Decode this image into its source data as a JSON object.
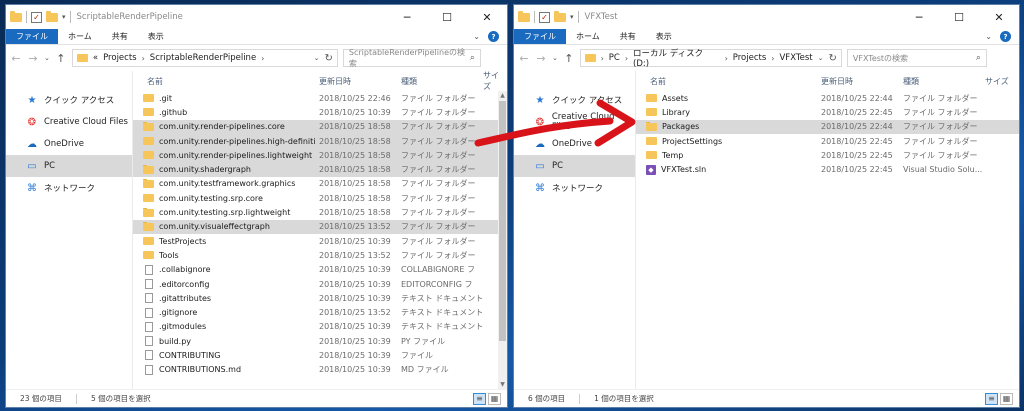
{
  "colors": {
    "accent": "#1a6bc0",
    "selection": "#d9d9d9",
    "folder": "#f6c65a",
    "arrow": "#d8141a"
  },
  "ribbon_tabs": [
    "ファイル",
    "ホーム",
    "共有",
    "表示"
  ],
  "columns": {
    "name": "名前",
    "date": "更新日時",
    "type": "種類",
    "size": "サイズ"
  },
  "nav": [
    {
      "label": "クイック アクセス",
      "icon": "star-icon"
    },
    {
      "label": "Creative Cloud Files",
      "icon": "creative-cloud-icon"
    },
    {
      "label": "OneDrive",
      "icon": "cloud-icon"
    },
    {
      "label": "PC",
      "icon": "computer-icon"
    },
    {
      "label": "ネットワーク",
      "icon": "network-icon"
    }
  ],
  "left": {
    "title": "ScriptableRenderPipeline",
    "path": [
      "«",
      "Projects",
      "ScriptableRenderPipeline"
    ],
    "search_placeholder": "ScriptableRenderPipelineの検索",
    "selected_nav": 3,
    "items": [
      {
        "name": ".git",
        "date": "2018/10/25 22:46",
        "type": "ファイル フォルダー",
        "icon": "folder",
        "selected": false
      },
      {
        "name": ".github",
        "date": "2018/10/25 10:39",
        "type": "ファイル フォルダー",
        "icon": "folder",
        "selected": false
      },
      {
        "name": "com.unity.render-pipelines.core",
        "date": "2018/10/25 18:58",
        "type": "ファイル フォルダー",
        "icon": "folder",
        "selected": true
      },
      {
        "name": "com.unity.render-pipelines.high-definition",
        "date": "2018/10/25 18:58",
        "type": "ファイル フォルダー",
        "icon": "folder",
        "selected": true
      },
      {
        "name": "com.unity.render-pipelines.lightweight",
        "date": "2018/10/25 18:58",
        "type": "ファイル フォルダー",
        "icon": "folder",
        "selected": true
      },
      {
        "name": "com.unity.shadergraph",
        "date": "2018/10/25 18:58",
        "type": "ファイル フォルダー",
        "icon": "folder",
        "selected": true
      },
      {
        "name": "com.unity.testframework.graphics",
        "date": "2018/10/25 18:58",
        "type": "ファイル フォルダー",
        "icon": "folder",
        "selected": false
      },
      {
        "name": "com.unity.testing.srp.core",
        "date": "2018/10/25 18:58",
        "type": "ファイル フォルダー",
        "icon": "folder",
        "selected": false
      },
      {
        "name": "com.unity.testing.srp.lightweight",
        "date": "2018/10/25 18:58",
        "type": "ファイル フォルダー",
        "icon": "folder",
        "selected": false
      },
      {
        "name": "com.unity.visualeffectgraph",
        "date": "2018/10/25 13:52",
        "type": "ファイル フォルダー",
        "icon": "folder",
        "selected": true
      },
      {
        "name": "TestProjects",
        "date": "2018/10/25 10:39",
        "type": "ファイル フォルダー",
        "icon": "folder",
        "selected": false
      },
      {
        "name": "Tools",
        "date": "2018/10/25 13:52",
        "type": "ファイル フォルダー",
        "icon": "folder",
        "selected": false
      },
      {
        "name": ".collabignore",
        "date": "2018/10/25 10:39",
        "type": "COLLABIGNORE フ",
        "icon": "file",
        "selected": false
      },
      {
        "name": ".editorconfig",
        "date": "2018/10/25 10:39",
        "type": "EDITORCONFIG フ",
        "icon": "file",
        "selected": false
      },
      {
        "name": ".gitattributes",
        "date": "2018/10/25 10:39",
        "type": "テキスト ドキュメント",
        "icon": "file",
        "selected": false
      },
      {
        "name": ".gitignore",
        "date": "2018/10/25 13:52",
        "type": "テキスト ドキュメント",
        "icon": "file",
        "selected": false
      },
      {
        "name": ".gitmodules",
        "date": "2018/10/25 10:39",
        "type": "テキスト ドキュメント",
        "icon": "file",
        "selected": false
      },
      {
        "name": "build.py",
        "date": "2018/10/25 10:39",
        "type": "PY ファイル",
        "icon": "file",
        "selected": false
      },
      {
        "name": "CONTRIBUTING",
        "date": "2018/10/25 10:39",
        "type": "ファイル",
        "icon": "file",
        "selected": false
      },
      {
        "name": "CONTRIBUTIONS.md",
        "date": "2018/10/25 10:39",
        "type": "MD ファイル",
        "icon": "file",
        "selected": false
      }
    ],
    "status_count": "23 個の項目",
    "status_selected": "5 個の項目を選択"
  },
  "right": {
    "title": "VFXTest",
    "path": [
      "PC",
      "ローカル ディスク (D:)",
      "Projects",
      "VFXTest"
    ],
    "search_placeholder": "VFXTestの検索",
    "selected_nav": 3,
    "items": [
      {
        "name": "Assets",
        "date": "2018/10/25 22:44",
        "type": "ファイル フォルダー",
        "icon": "folder",
        "selected": false
      },
      {
        "name": "Library",
        "date": "2018/10/25 22:45",
        "type": "ファイル フォルダー",
        "icon": "folder",
        "selected": false
      },
      {
        "name": "Packages",
        "date": "2018/10/25 22:44",
        "type": "ファイル フォルダー",
        "icon": "folder",
        "selected": true
      },
      {
        "name": "ProjectSettings",
        "date": "2018/10/25 22:45",
        "type": "ファイル フォルダー",
        "icon": "folder",
        "selected": false
      },
      {
        "name": "Temp",
        "date": "2018/10/25 22:45",
        "type": "ファイル フォルダー",
        "icon": "folder",
        "selected": false
      },
      {
        "name": "VFXTest.sln",
        "date": "2018/10/25 22:45",
        "type": "Visual Studio Solu...",
        "icon": "sln",
        "selected": false
      }
    ],
    "status_count": "6 個の項目",
    "status_selected": "1 個の項目を選択"
  }
}
